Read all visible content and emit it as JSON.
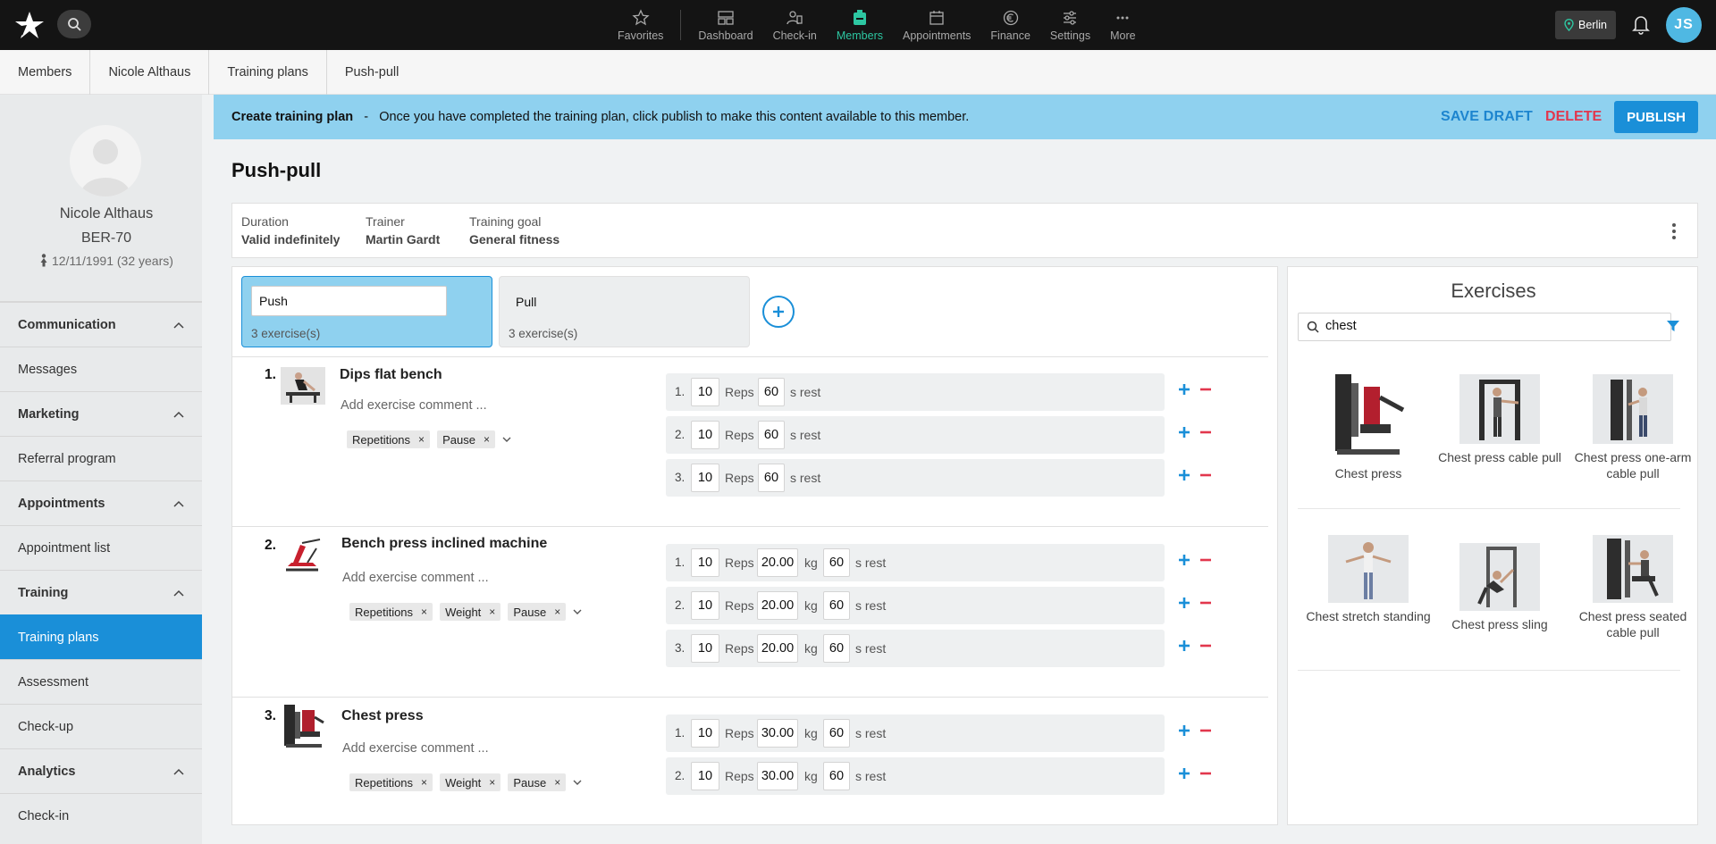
{
  "topbar": {
    "nav": [
      {
        "label": "Favorites",
        "icon": "star-icon"
      },
      {
        "label": "Dashboard",
        "icon": "dashboard-icon"
      },
      {
        "label": "Check-in",
        "icon": "check-in-icon"
      },
      {
        "label": "Members",
        "icon": "members-icon",
        "active": true
      },
      {
        "label": "Appointments",
        "icon": "calendar-icon"
      },
      {
        "label": "Finance",
        "icon": "euro-icon"
      },
      {
        "label": "Settings",
        "icon": "settings-sliders-icon"
      },
      {
        "label": "More",
        "icon": "more-dots-icon"
      }
    ],
    "location": "Berlin",
    "user_initials": "JS",
    "accent": "#2dc7a2"
  },
  "breadcrumb": [
    "Members",
    "Nicole Althaus",
    "Training plans",
    "Push-pull"
  ],
  "profile": {
    "name": "Nicole Althaus",
    "member_id": "BER-70",
    "birthday": "12/11/1991 (32 years)"
  },
  "sidebar": {
    "sections": [
      {
        "title": "Communication",
        "items": [
          "Messages"
        ]
      },
      {
        "title": "Marketing",
        "items": [
          "Referral program"
        ]
      },
      {
        "title": "Appointments",
        "items": [
          "Appointment list"
        ]
      },
      {
        "title": "Training",
        "items": [
          "Training plans",
          "Assessment",
          "Check-up"
        ]
      },
      {
        "title": "Analytics",
        "items": [
          "Check-in"
        ]
      }
    ],
    "active_item": "Training plans"
  },
  "banner": {
    "title": "Create training plan",
    "text": "Once you have completed the training plan, click publish to make this content available to this member.",
    "save_draft": "SAVE DRAFT",
    "delete": "DELETE",
    "publish": "PUBLISH"
  },
  "plan": {
    "title": "Push-pull",
    "duration_label": "Duration",
    "duration": "Valid indefinitely",
    "trainer_label": "Trainer",
    "trainer": "Martin Gardt",
    "goal_label": "Training goal",
    "goal": "General fitness"
  },
  "days": [
    {
      "name": "Push",
      "count": "3 exercise(s)",
      "active": true
    },
    {
      "name": "Pull",
      "count": "3 exercise(s)",
      "active": false
    }
  ],
  "exercises": [
    {
      "number": "1.",
      "name": "Dips flat bench",
      "comment_placeholder": "Add exercise comment ...",
      "tags": [
        "Repetitions",
        "Pause"
      ],
      "sets": [
        {
          "no": "1.",
          "reps": "10",
          "rest": "60"
        },
        {
          "no": "2.",
          "reps": "10",
          "rest": "60"
        },
        {
          "no": "3.",
          "reps": "10",
          "rest": "60"
        }
      ]
    },
    {
      "number": "2.",
      "name": "Bench press inclined machine",
      "comment_placeholder": "Add exercise comment ...",
      "tags": [
        "Repetitions",
        "Weight",
        "Pause"
      ],
      "sets": [
        {
          "no": "1.",
          "reps": "10",
          "weight": "20.00",
          "rest": "60"
        },
        {
          "no": "2.",
          "reps": "10",
          "weight": "20.00",
          "rest": "60"
        },
        {
          "no": "3.",
          "reps": "10",
          "weight": "20.00",
          "rest": "60"
        }
      ]
    },
    {
      "number": "3.",
      "name": "Chest press",
      "comment_placeholder": "Add exercise comment ...",
      "tags": [
        "Repetitions",
        "Weight",
        "Pause"
      ],
      "sets": [
        {
          "no": "1.",
          "reps": "10",
          "weight": "30.00",
          "rest": "60"
        },
        {
          "no": "2.",
          "reps": "10",
          "weight": "30.00",
          "rest": "60"
        }
      ]
    }
  ],
  "units": {
    "reps": "Reps",
    "kg": "kg",
    "rest": "s rest"
  },
  "library": {
    "title": "Exercises",
    "search_value": "chest",
    "items": [
      "Chest press",
      "Chest press cable pull",
      "Chest press one-arm cable pull",
      "Chest stretch standing",
      "Chest press sling",
      "Chest press seated cable pull"
    ]
  },
  "colors": {
    "primary": "#1a8fd8",
    "banner": "#8fd1ef",
    "danger": "#e2374d"
  }
}
